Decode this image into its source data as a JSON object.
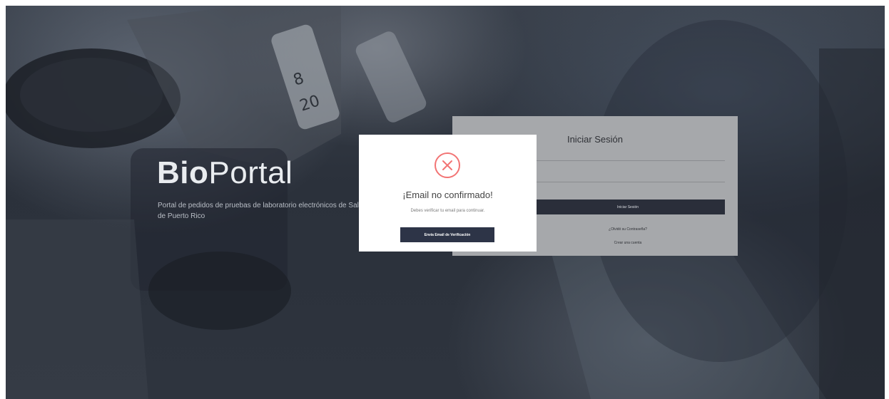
{
  "brand": {
    "bold": "Bio",
    "regular": "Portal"
  },
  "tagline": "Portal de pedidos de pruebas de laboratorio electrónicos de Salud de Puerto Rico",
  "login": {
    "title": "Iniciar Sesión",
    "submit_label": "Iniciar Sesión",
    "forgot_link": "¿Olvidó su Contraseña?",
    "create_link": "Crear una cuenta"
  },
  "modal": {
    "icon": "error-x-icon",
    "title": "¡Email no confirmado!",
    "message": "Debes verificar tu email para continuar.",
    "button_label": "Envía Email de Verificación"
  },
  "colors": {
    "error_red": "#f27474",
    "button_dark": "#2d3447",
    "card_gray": "#a6a8ab"
  }
}
